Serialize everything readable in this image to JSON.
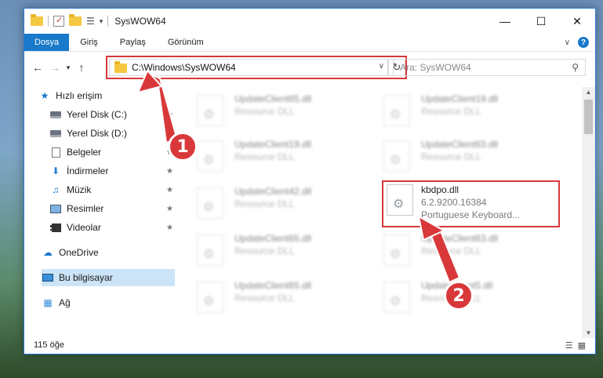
{
  "window": {
    "title": "SysWOW64"
  },
  "ribbon": {
    "tabs": [
      "Dosya",
      "Giriş",
      "Paylaş",
      "Görünüm"
    ]
  },
  "address": {
    "path": "C:\\Windows\\SysWOW64"
  },
  "search": {
    "placeholder": "Ara: SysWOW64"
  },
  "sidebar": {
    "items": [
      {
        "label": "Hızlı erişim",
        "icon": "star-icon"
      },
      {
        "label": "Yerel Disk (C:)",
        "icon": "drive-icon"
      },
      {
        "label": "Yerel Disk (D:)",
        "icon": "drive-icon"
      },
      {
        "label": "Belgeler",
        "icon": "documents-icon"
      },
      {
        "label": "İndirmeler",
        "icon": "download-icon"
      },
      {
        "label": "Müzik",
        "icon": "music-icon"
      },
      {
        "label": "Resimler",
        "icon": "pictures-icon"
      },
      {
        "label": "Videolar",
        "icon": "videos-icon"
      },
      {
        "label": "OneDrive",
        "icon": "cloud-icon"
      },
      {
        "label": "Bu bilgisayar",
        "icon": "computer-icon"
      },
      {
        "label": "Ağ",
        "icon": "network-icon"
      }
    ]
  },
  "files": [
    {
      "name": "UpdateClient65.dll",
      "type": "Resource DLL"
    },
    {
      "name": "UpdateClient19.dll",
      "type": "Resource DLL"
    },
    {
      "name": "UpdateClient19.dll",
      "type": "Resource DLL"
    },
    {
      "name": "UpdateClient63.dll",
      "type": "Resource DLL"
    },
    {
      "name": "UpdateClient42.dll",
      "type": "Resource DLL"
    },
    {
      "name": "kbdpo.dll",
      "version": "6.2.9200.16384",
      "description": "Portuguese Keyboard..."
    },
    {
      "name": "UpdateClient65.dll",
      "type": "Resource DLL"
    },
    {
      "name": "UpdateClient63.dll",
      "type": "Resource DLL"
    },
    {
      "name": "UpdateClient65.dll",
      "type": "Resource DLL"
    },
    {
      "name": "UpdateClient5.dll",
      "type": "Resource DLL"
    }
  ],
  "status": {
    "item_count": "115 öğe"
  },
  "callouts": [
    "1",
    "2"
  ],
  "colors": {
    "accent": "#1979ca",
    "annotation": "#d9383a",
    "selected": "#cce4f7"
  }
}
